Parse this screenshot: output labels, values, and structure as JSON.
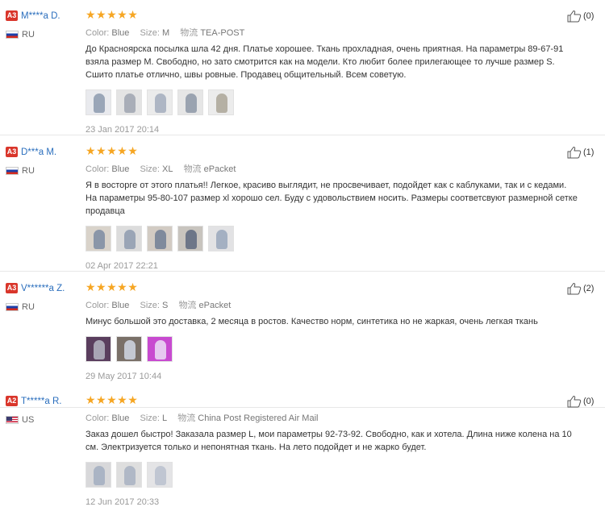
{
  "labels": {
    "color": "Color:",
    "size": "Size:",
    "shipping_prefix": "物流"
  },
  "colors": {
    "badge": "#d9362b",
    "username": "#2a6ebd",
    "star": "#f6a623"
  },
  "reviews": [
    {
      "badge": "A3",
      "user": "M****a D.",
      "country": "RU",
      "flag": "ru",
      "stars": "★★★★★",
      "color": "Blue",
      "size": "M",
      "shipping": "TEA-POST",
      "text": "До Красноярска посылка шла 42 дня. Платье хорошее. Ткань прохладная, очень приятная. На параметры 89-67-91 взяла размер М. Свободно, но зато смотрится как на модели. Кто любит более прилегающее то лучше размер S. Сшито платье отлично, швы ровные. Продавец общительный. Всем советую.",
      "photos": [
        {
          "bg": "#e9eaee",
          "fig": "#9aa6b8"
        },
        {
          "bg": "#e4e4e4",
          "fig": "#a9aeb8"
        },
        {
          "bg": "#ebebeb",
          "fig": "#aeb6c4"
        },
        {
          "bg": "#e6e6e6",
          "fig": "#9aa3b0"
        },
        {
          "bg": "#ececec",
          "fig": "#b5b0a4"
        }
      ],
      "date": "23 Jan 2017 20:14",
      "helpful": "(0)"
    },
    {
      "badge": "A3",
      "user": "D***a M.",
      "country": "RU",
      "flag": "ru",
      "stars": "★★★★★",
      "color": "Blue",
      "size": "XL",
      "shipping": "ePacket",
      "text": "Я в восторге от этого платья!! Легкое, красиво выглядит, не просвечивает, подойдет как с каблуками, так и с кедами. На параметры 95-80-107 размер xl хорошо сел. Буду с удовольствием носить. Размеры соответсвуют размерной сетке продавца",
      "photos": [
        {
          "bg": "#d9d3ca",
          "fig": "#8a96a8"
        },
        {
          "bg": "#dcdcdc",
          "fig": "#9aa5b6"
        },
        {
          "bg": "#d2cbc3",
          "fig": "#7f8a9c"
        },
        {
          "bg": "#c8c4be",
          "fig": "#6d7688"
        },
        {
          "bg": "#e2e2e4",
          "fig": "#a4b0c2"
        }
      ],
      "date": "02 Apr 2017 22:21",
      "helpful": "(1)"
    },
    {
      "badge": "A3",
      "user": "V******a Z.",
      "country": "RU",
      "flag": "ru",
      "stars": "★★★★★",
      "color": "Blue",
      "size": "S",
      "shipping": "ePacket",
      "text": "Минус большой это доставка, 2 месяца в ростов. Качество норм, синтетика но не жаркая, очень легкая ткань",
      "photos": [
        {
          "bg": "#5a3e5e",
          "fig": "#a8a4b4"
        },
        {
          "bg": "#7a7068",
          "fig": "#c4c8d2"
        },
        {
          "bg": "#c84ad0",
          "fig": "#e6c8f0"
        }
      ],
      "date": "29 May 2017 10:44",
      "helpful": "(2)"
    },
    {
      "badge": "A2",
      "user": "T*****a R.",
      "country": "US",
      "flag": "us",
      "stars": "★★★★★",
      "color": "Blue",
      "size": "L",
      "shipping": "China Post Registered Air Mail",
      "text": "Заказ дошел быстро! Заказала размер L, мои параметры 92-73-92. Свободно, как и хотела. Длина ниже колена на 10 см. Электризуется только и непонятная ткань. На лето подойдет и не жарко будет.",
      "photos": [
        {
          "bg": "#d8d8da",
          "fig": "#aab4c4"
        },
        {
          "bg": "#dedede",
          "fig": "#b0b8c6"
        },
        {
          "bg": "#e4e4e6",
          "fig": "#c0c6d2"
        }
      ],
      "date": "12 Jun 2017 20:33",
      "helpful": "(0)"
    }
  ]
}
